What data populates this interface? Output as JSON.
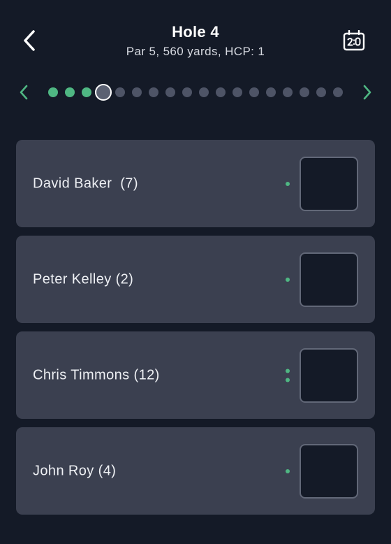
{
  "header": {
    "back_icon": "chevron-left-icon",
    "title": "Hole 4",
    "subtitle": "Par 5, 560 yards, HCP: 1",
    "scorecard_icon": "scoreboard-icon"
  },
  "hole_nav": {
    "prev_icon": "chevron-left-icon",
    "next_icon": "chevron-right-icon",
    "total_holes": 18,
    "current_hole": 4,
    "played_holes": [
      1,
      2,
      3
    ]
  },
  "players": [
    {
      "name": "David Baker  (7)",
      "strokes_received": 1,
      "score": ""
    },
    {
      "name": "Peter Kelley (2)",
      "strokes_received": 1,
      "score": ""
    },
    {
      "name": "Chris Timmons (12)",
      "strokes_received": 2,
      "score": ""
    },
    {
      "name": "John Roy (4)",
      "strokes_received": 1,
      "score": ""
    }
  ],
  "colors": {
    "background": "#141a27",
    "card": "#3b4050",
    "accent_green": "#4fb783",
    "dot_inactive": "#4e5466",
    "text": "#ffffff"
  }
}
